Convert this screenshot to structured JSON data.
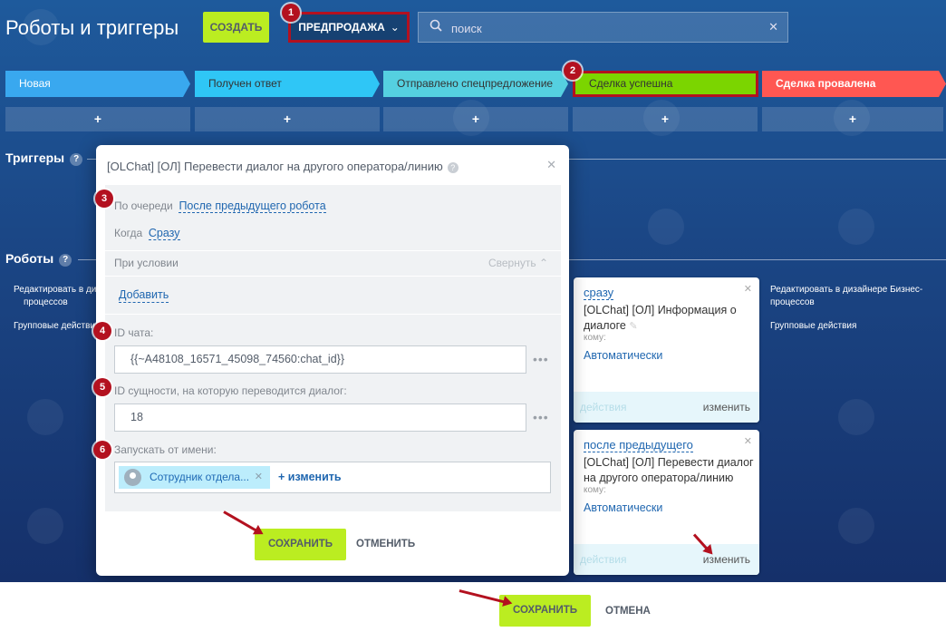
{
  "header": {
    "title": "Роботы и триггеры",
    "create_label": "СОЗДАТЬ",
    "pipeline_label": "ПРЕДПРОДАЖА",
    "search_placeholder": "поиск"
  },
  "badges": [
    "1",
    "2",
    "3",
    "4",
    "5",
    "6"
  ],
  "stages": [
    {
      "label": "Новая",
      "color": "#39a8ef"
    },
    {
      "label": "Получен ответ",
      "color": "#2fc6f6"
    },
    {
      "label": "Отправлено спецпредложение",
      "color": "#55d0e0"
    },
    {
      "label": "Сделка успешна",
      "color": "#7bd500"
    },
    {
      "label": "Сделка провалена",
      "color": "#ff5752"
    }
  ],
  "add_symbol": "+",
  "sections": {
    "triggers": "Триггеры",
    "robots": "Роботы",
    "help_symbol": "?"
  },
  "column_links": {
    "edit_designer": "Редактировать в дизайнере Бизнес-процессов",
    "edit_designer_short": "Редактировать в ди...",
    "group_actions": "Групповые действия",
    "group_actions_short": "Групповые действия"
  },
  "robot_cards": [
    {
      "when": "сразу",
      "title": "[OLChat] [ОЛ] Информация о диалоге",
      "to_label": "кому:",
      "to_value": "Автоматически",
      "actions": "действия",
      "edit": "изменить"
    },
    {
      "when": "после предыдущего",
      "title": "[OLChat] [ОЛ] Перевести диалог на другого оператора/линию",
      "to_label": "кому:",
      "to_value": "Автоматически",
      "actions": "действия",
      "edit": "изменить"
    }
  ],
  "dialog": {
    "title": "[OLChat] [ОЛ] Перевести диалог на другого оператора/линию",
    "queue_label": "По очереди",
    "queue_value": "После предыдущего робота",
    "when_label": "Когда",
    "when_value": "Сразу",
    "condition_label": "При условии",
    "collapse_label": "Свернуть",
    "add_label": "Добавить",
    "chat_id_label": "ID чата:",
    "chat_id_value": "{{~A48108_16571_45098_74560:chat_id}}",
    "entity_id_label": "ID сущности, на которую переводится диалог:",
    "entity_id_value": "18",
    "run_as_label": "Запускать от имени:",
    "run_as_user": "Сотрудник отдела...",
    "change_label": "+ изменить",
    "dots": "•••",
    "save_label": "СОХРАНИТЬ",
    "cancel_label": "ОТМЕНИТЬ"
  },
  "footer": {
    "save_label": "СОХРАНИТЬ",
    "cancel_label": "ОТМЕНА"
  }
}
